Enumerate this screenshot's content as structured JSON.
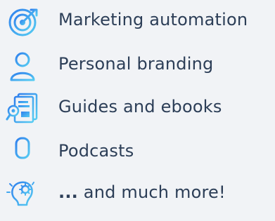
{
  "items": [
    {
      "label": "Marketing automation",
      "icon": "target-icon"
    },
    {
      "label": "Personal branding",
      "icon": "person-icon"
    },
    {
      "label": "Guides and ebooks",
      "icon": "document-magnifier-icon"
    },
    {
      "label": "Podcasts",
      "icon": "microphone-icon"
    },
    {
      "label_prefix": "...",
      "label": " and much more!",
      "icon": "lightbulb-gear-icon"
    }
  ],
  "colors": {
    "background": "#f1f3f6",
    "text": "#2c3e57",
    "icon_gradient_start": "#2f80ed",
    "icon_gradient_end": "#56ccf2"
  }
}
